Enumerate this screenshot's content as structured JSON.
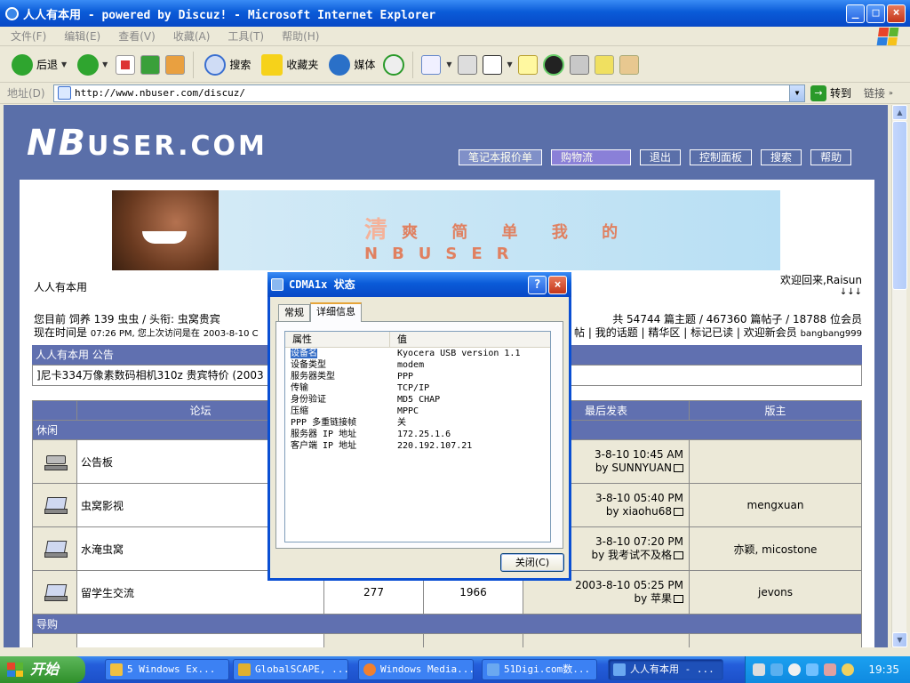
{
  "window": {
    "title": "人人有本用 - powered by Discuz! - Microsoft Internet Explorer",
    "controls": [
      "_",
      "□",
      "×"
    ]
  },
  "menu": [
    "文件(F)",
    "编辑(E)",
    "查看(V)",
    "收藏(A)",
    "工具(T)",
    "帮助(H)"
  ],
  "toolbar": {
    "back": "后退",
    "search": "搜索",
    "favorites": "收藏夹",
    "media": "媒体"
  },
  "address": {
    "label": "地址(D)",
    "url": "http://www.nbuser.com/discuz/",
    "go": "转到",
    "links": "链接"
  },
  "site": {
    "logo_main": "NB",
    "logo_rest": "USER.COM",
    "nav": [
      "笔记本报价单",
      "购物流",
      "退出",
      "控制面板",
      "搜索",
      "帮助"
    ],
    "banner_slogan_first": "清",
    "banner_slogan_rest": "爽 简 单 我 的 NBUSER",
    "name": "人人有本用",
    "welcome": "欢迎回来,Raisun",
    "welcome_arrows": "↓↓↓",
    "user_line1": "您目前 饲养 139 虫虫 / 头衔: 虫窝贵宾",
    "user_line2_a": "现在时间是",
    "user_line2_time": "07:26 PM, 您上次访问是在",
    "user_line2_date": "2003-8-10 C",
    "stats_line1": "共 54744 篇主题 / 467360 篇帖子 / 18788 位会员",
    "stats_line2": "帖 | 我的话题 | 精华区 | 标记已读 | 欢迎新会员",
    "stats_user": "bangbang999",
    "announce_title": "人人有本用 公告",
    "announce_text": "]尼卡334万像素数码相机310z 贵宾特价 (2003"
  },
  "forum": {
    "headers": [
      "论坛",
      "最后发表",
      "版主"
    ],
    "cat1": "休闲",
    "cat2": "导购",
    "rows": [
      {
        "name": "公告板",
        "topics": "",
        "posts": "",
        "last_date": "3-8-10 10:45 AM",
        "last_by": "by SUNNYUAN",
        "mod": ""
      },
      {
        "name": "虫窝影视",
        "topics": "",
        "posts": "",
        "last_date": "3-8-10 05:40 PM",
        "last_by": "by xiaohu68",
        "mod": "mengxuan"
      },
      {
        "name": "水淹虫窝",
        "topics": "",
        "posts": "",
        "last_date": "3-8-10 07:20 PM",
        "last_by": "by 我考试不及格",
        "mod": "亦颖, micostone"
      },
      {
        "name": "留学生交流",
        "topics": "277",
        "posts": "1966",
        "last_date": "2003-8-10 05:25 PM",
        "last_by": "by 苹果",
        "mod": "jevons"
      }
    ]
  },
  "dialog": {
    "title": "CDMA1x 状态",
    "tabs": [
      "常规",
      "详细信息"
    ],
    "col_prop": "属性",
    "col_val": "值",
    "rows": [
      {
        "k": "设备名",
        "v": "Kyocera USB version 1.1"
      },
      {
        "k": "设备类型",
        "v": "modem"
      },
      {
        "k": "服务器类型",
        "v": "PPP"
      },
      {
        "k": "传输",
        "v": "TCP/IP"
      },
      {
        "k": "身份验证",
        "v": "MD5 CHAP"
      },
      {
        "k": "压缩",
        "v": "MPPC"
      },
      {
        "k": "PPP 多重链接帧",
        "v": "关"
      },
      {
        "k": "服务器 IP 地址",
        "v": "172.25.1.6"
      },
      {
        "k": "客户端 IP 地址",
        "v": "220.192.107.21"
      }
    ],
    "close": "关闭(C)"
  },
  "taskbar": {
    "start": "开始",
    "tasks": [
      "5 Windows Ex...",
      "GlobalSCAPE, ...",
      "Windows Media...",
      "51Digi.com数...",
      "人人有本用 - ..."
    ],
    "clock": "19:35"
  }
}
